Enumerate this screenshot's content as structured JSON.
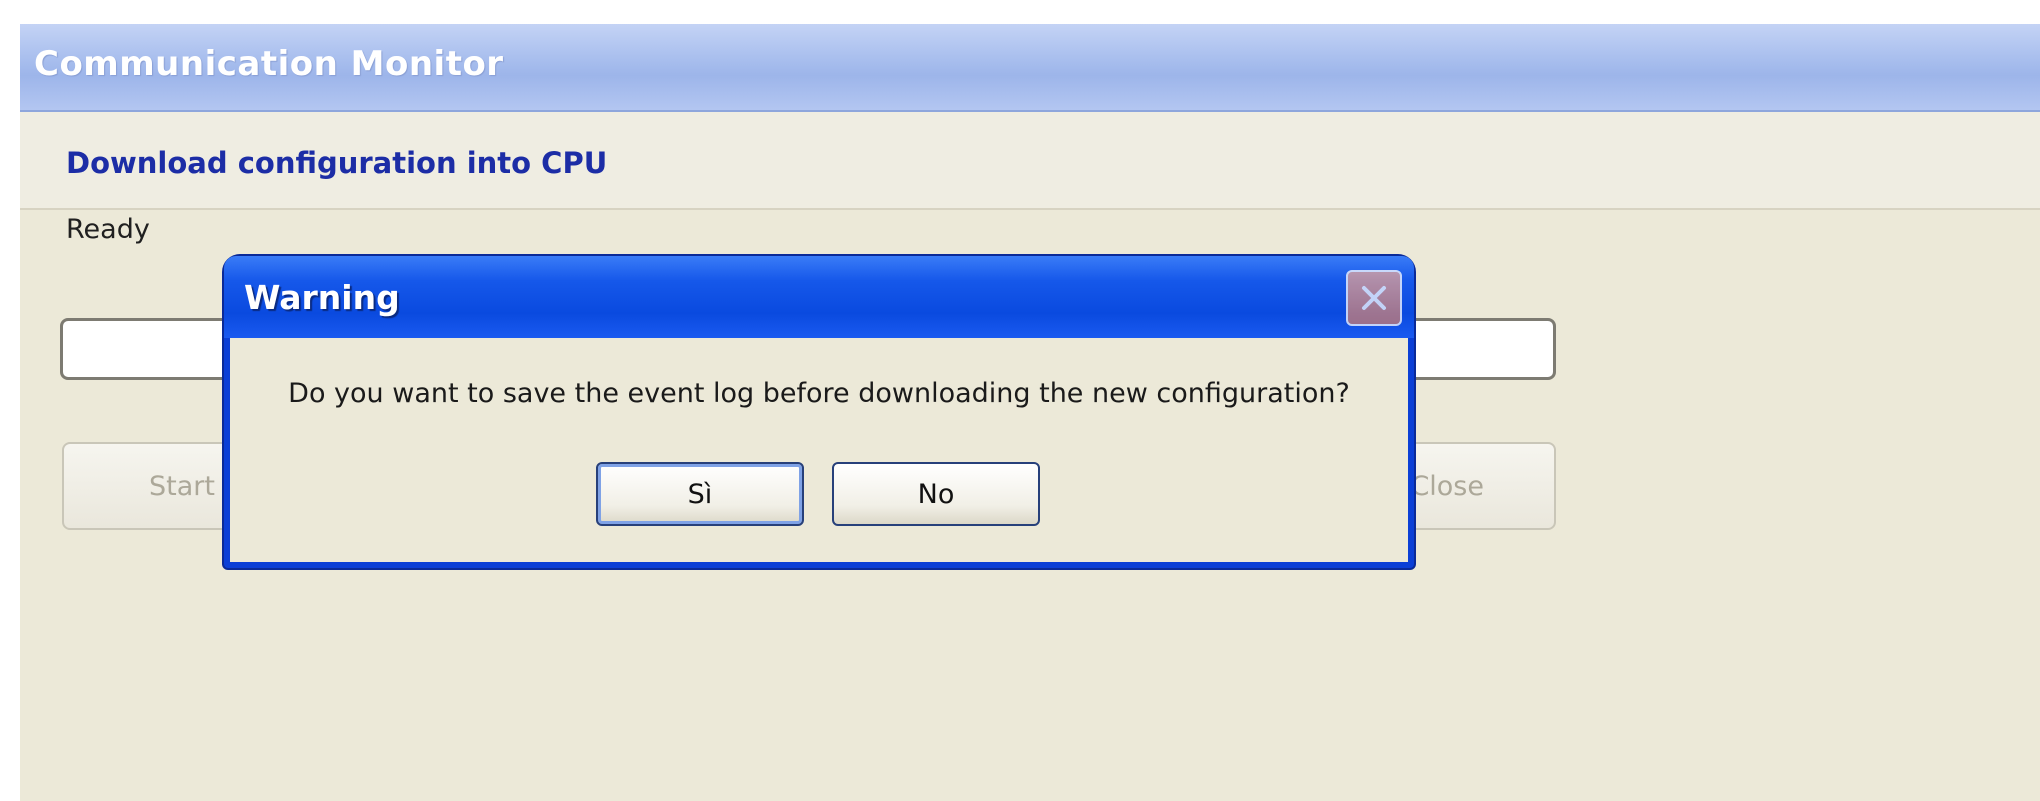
{
  "background_window": {
    "title": "Communication Monitor",
    "header": "Download configuration into CPU",
    "status": "Ready",
    "buttons": {
      "start_label": "Start",
      "close_label": "Close"
    }
  },
  "dialog": {
    "title": "Warning",
    "message": "Do you want to save the event log before downloading the new configuration?",
    "buttons": {
      "yes_label": "Sì",
      "no_label": "No"
    },
    "close_icon": "close-icon"
  },
  "colors": {
    "dialog_title_bar": "#0b3fd6",
    "header_text": "#1c2da6",
    "window_face": "#ece9d8"
  }
}
